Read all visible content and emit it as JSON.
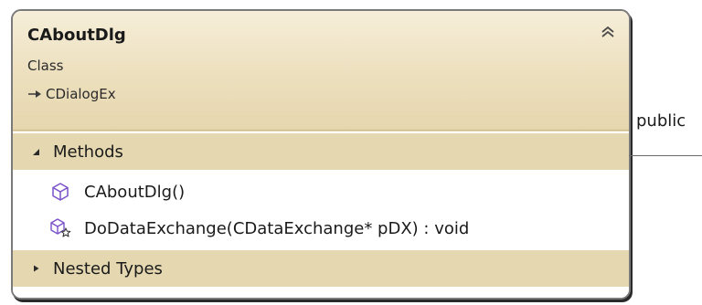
{
  "class": {
    "name": "CAboutDlg",
    "stereotype": "Class",
    "base_class": "CDialogEx",
    "collapse_icon": "double-chevron-up-icon"
  },
  "compartments": {
    "methods": {
      "label": "Methods",
      "expanded": true,
      "items": [
        {
          "label": "CAboutDlg()",
          "icon": "public-method-icon"
        },
        {
          "label": "DoDataExchange(CDataExchange* pDX) : void",
          "icon": "protected-method-icon"
        }
      ]
    },
    "nested_types": {
      "label": "Nested Types",
      "expanded": false
    }
  },
  "connector": {
    "label": "public"
  },
  "colors": {
    "header_fill": "#ecdfbd",
    "compartment_fill": "#e5d8b1",
    "border": "#7a7a7a",
    "icon_purple": "#7b52c9"
  }
}
